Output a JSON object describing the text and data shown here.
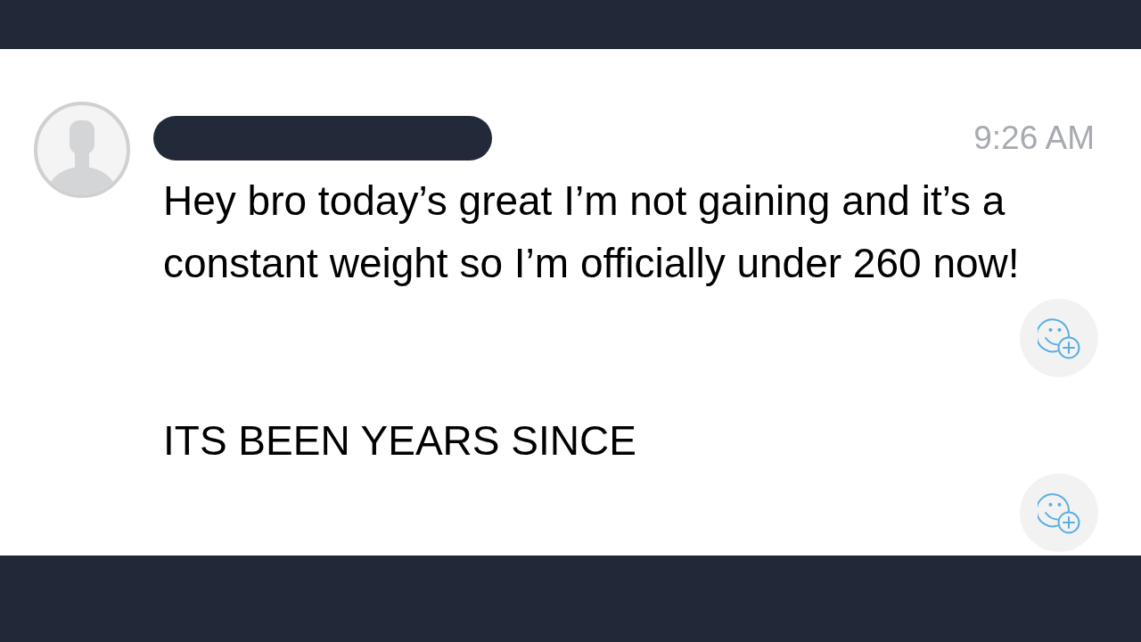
{
  "post": {
    "time": "9:26 AM",
    "messages": [
      {
        "text": "Hey bro today’s great I’m not gaining and it’s a constant weight so I’m officially under 260 now!"
      },
      {
        "text": "ITS BEEN YEARS SINCE"
      }
    ]
  }
}
